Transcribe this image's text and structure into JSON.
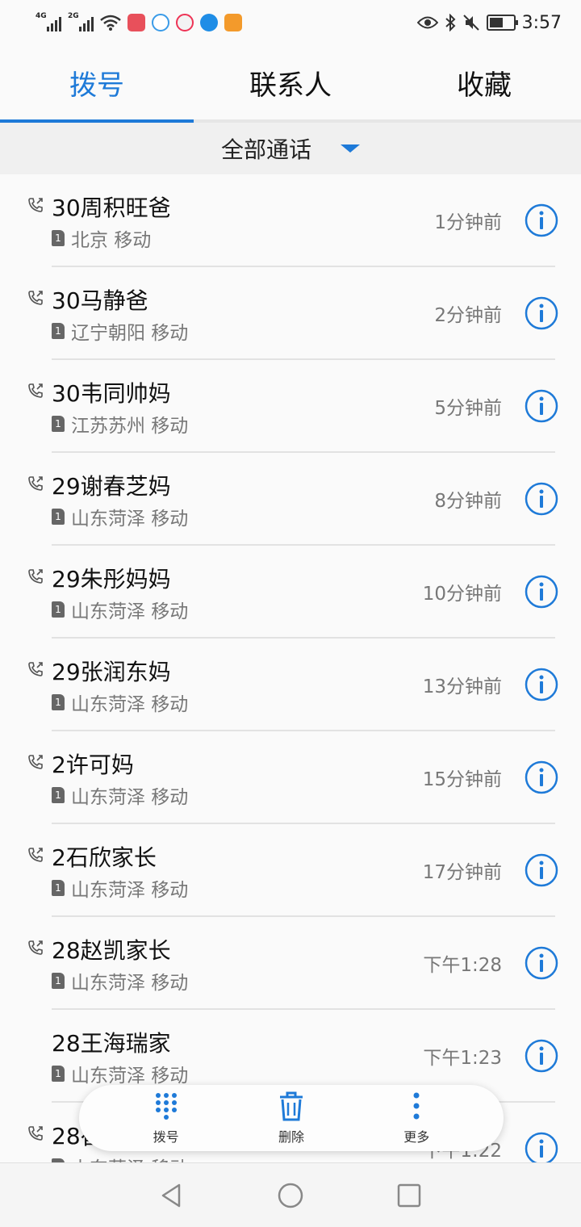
{
  "status_bar": {
    "net1": "4G",
    "net2": "2G",
    "time": "3:57",
    "battery_level": 0.6
  },
  "tabs": [
    {
      "label": "拨号",
      "active": true
    },
    {
      "label": "联系人",
      "active": false
    },
    {
      "label": "收藏",
      "active": false
    }
  ],
  "filter": {
    "label": "全部通话"
  },
  "calls": [
    {
      "name": "30周积旺爸",
      "location": "北京 移动",
      "sim": "1",
      "time": "1分钟前",
      "outgoing": true
    },
    {
      "name": "30马静爸",
      "location": "辽宁朝阳 移动",
      "sim": "1",
      "time": "2分钟前",
      "outgoing": true
    },
    {
      "name": "30韦同帅妈",
      "location": "江苏苏州 移动",
      "sim": "1",
      "time": "5分钟前",
      "outgoing": true
    },
    {
      "name": "29谢春芝妈",
      "location": "山东菏泽 移动",
      "sim": "1",
      "time": "8分钟前",
      "outgoing": true
    },
    {
      "name": "29朱彤妈妈",
      "location": "山东菏泽 移动",
      "sim": "1",
      "time": "10分钟前",
      "outgoing": true
    },
    {
      "name": "29张润东妈",
      "location": "山东菏泽 移动",
      "sim": "1",
      "time": "13分钟前",
      "outgoing": true
    },
    {
      "name": "2许可妈",
      "location": "山东菏泽 移动",
      "sim": "1",
      "time": "15分钟前",
      "outgoing": true
    },
    {
      "name": "2石欣家长",
      "location": "山东菏泽 移动",
      "sim": "1",
      "time": "17分钟前",
      "outgoing": true
    },
    {
      "name": "28赵凯家长",
      "location": "山东菏泽 移动",
      "sim": "1",
      "time": "下午1:28",
      "outgoing": true
    },
    {
      "name": "28王海瑞家",
      "location": "山东菏泽 移动",
      "sim": "1",
      "time": "下午1:23",
      "outgoing": false
    },
    {
      "name": "28崔紫煜",
      "location": "山东菏泽 移动",
      "sim": "1",
      "time": "下午1:22",
      "outgoing": true
    }
  ],
  "action_bar": {
    "dial_label": "拨号",
    "delete_label": "删除",
    "more_label": "更多"
  },
  "colors": {
    "accent": "#1e7ad8"
  }
}
